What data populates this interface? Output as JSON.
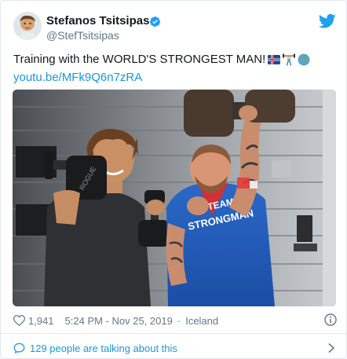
{
  "author": {
    "name": "Stefanos Tsitsipas",
    "handle": "@StefTsitsipas"
  },
  "tweet": {
    "text": "Training with the WORLD'S STRONGEST MAN!",
    "emojis": [
      "iceland-flag-icon",
      "weightlifter-icon",
      "globe-icon"
    ],
    "link": "youtu.be/MFk9Q6n7zRA"
  },
  "meta": {
    "likes": "1,941",
    "time": "5:24 PM - Nov 25, 2019",
    "separator": "·",
    "place": "Iceland"
  },
  "conversation": {
    "label": "129 people are talking about this"
  },
  "colors": {
    "link": "#1b95e0",
    "muted": "#657786",
    "twitter_blue": "#1da1f2",
    "verified": "#1da1f2"
  }
}
